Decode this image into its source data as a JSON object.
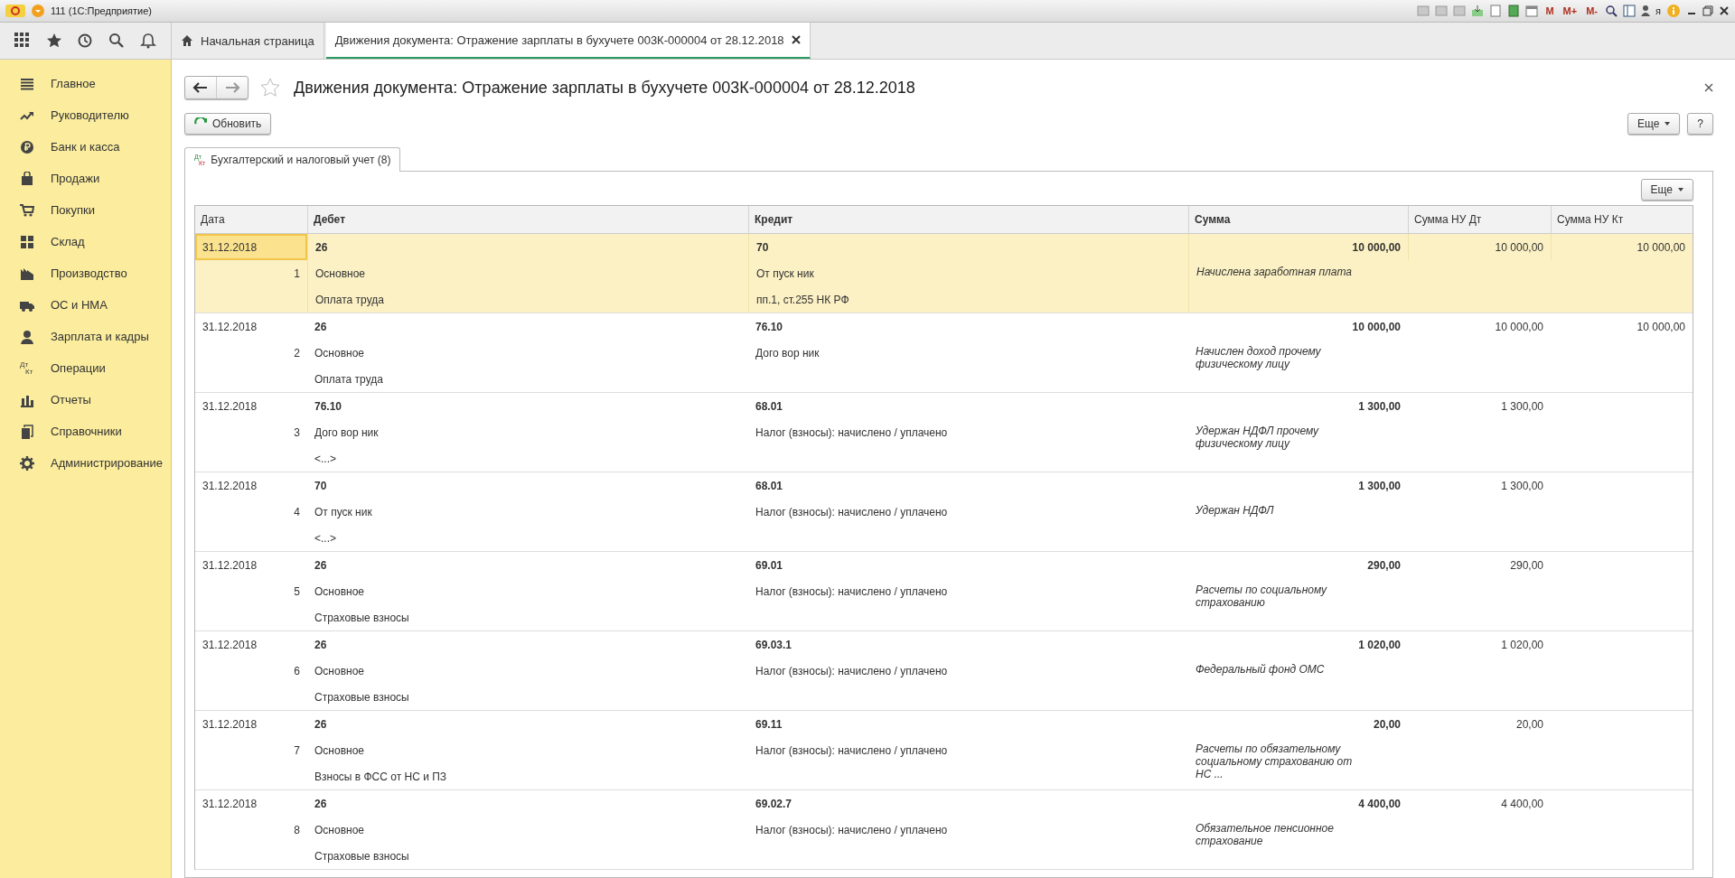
{
  "window": {
    "title": "111 (1С:Предприятие)",
    "memory_buttons": [
      "M",
      "M+",
      "M-"
    ],
    "user": "я"
  },
  "nav_tabs": [
    {
      "label": "Начальная страница",
      "selected": false
    },
    {
      "label": "Движения документа: Отражение зарплаты в бухучете 003К-000004 от 28.12.2018",
      "selected": true
    }
  ],
  "sidebar": {
    "items": [
      {
        "label": "Главное"
      },
      {
        "label": "Руководителю"
      },
      {
        "label": "Банк и касса"
      },
      {
        "label": "Продажи"
      },
      {
        "label": "Покупки"
      },
      {
        "label": "Склад"
      },
      {
        "label": "Производство"
      },
      {
        "label": "ОС и НМА"
      },
      {
        "label": "Зарплата и кадры"
      },
      {
        "label": "Операции",
        "icon_labels": [
          "Дт",
          "Кт"
        ]
      },
      {
        "label": "Отчеты"
      },
      {
        "label": "Справочники"
      },
      {
        "label": "Администрирование"
      }
    ]
  },
  "page": {
    "title": "Движения документа: Отражение зарплаты в бухучете 003К-000004 от 28.12.2018",
    "refresh_button": "Обновить",
    "more_button": "Еще",
    "help_button": "?"
  },
  "section_tabs": [
    {
      "label": "Бухгалтерский и налоговый учет (8)",
      "icon_labels": [
        "Дт",
        "Кт"
      ],
      "selected": true
    }
  ],
  "table": {
    "more_button": "Еще",
    "columns": [
      "Дата",
      "Дебет",
      "Кредит",
      "Сумма",
      "Сумма НУ Дт",
      "Сумма НУ Кт"
    ],
    "rows": [
      {
        "selected": true,
        "date": "31.12.2018",
        "number": "1",
        "debit": [
          "26",
          "Основное",
          "Оплата труда"
        ],
        "credit": [
          "70",
          "От пуск ник",
          "пп.1, ст.255 НК РФ"
        ],
        "amount": "10 000,00",
        "description": "Начислена заработная плата",
        "nu_dt": "10 000,00",
        "nu_kt": "10 000,00"
      },
      {
        "selected": false,
        "date": "31.12.2018",
        "number": "2",
        "debit": [
          "26",
          "Основное",
          "Оплата труда"
        ],
        "credit": [
          "76.10",
          "Дого вор ник"
        ],
        "amount": "10 000,00",
        "description": "Начислен доход прочему физическому лицу",
        "nu_dt": "10 000,00",
        "nu_kt": "10 000,00"
      },
      {
        "selected": false,
        "date": "31.12.2018",
        "number": "3",
        "debit": [
          "76.10",
          "Дого вор ник",
          "<...>"
        ],
        "credit": [
          "68.01",
          "Налог (взносы): начислено / уплачено"
        ],
        "amount": "1 300,00",
        "description": "Удержан НДФЛ прочему физическому лицу",
        "nu_dt": "1 300,00"
      },
      {
        "selected": false,
        "date": "31.12.2018",
        "number": "4",
        "debit": [
          "70",
          "От пуск ник",
          "<...>"
        ],
        "credit": [
          "68.01",
          "Налог (взносы): начислено / уплачено"
        ],
        "amount": "1 300,00",
        "description": "Удержан НДФЛ",
        "nu_dt": "1 300,00"
      },
      {
        "selected": false,
        "date": "31.12.2018",
        "number": "5",
        "debit": [
          "26",
          "Основное",
          "Страховые взносы"
        ],
        "credit": [
          "69.01",
          "Налог (взносы): начислено / уплачено"
        ],
        "amount": "290,00",
        "description": "Расчеты по социальному страхованию",
        "nu_dt": "290,00"
      },
      {
        "selected": false,
        "date": "31.12.2018",
        "number": "6",
        "debit": [
          "26",
          "Основное",
          "Страховые взносы"
        ],
        "credit": [
          "69.03.1",
          "Налог (взносы): начислено / уплачено"
        ],
        "amount": "1 020,00",
        "description": "Федеральный фонд ОМС",
        "nu_dt": "1 020,00"
      },
      {
        "selected": false,
        "date": "31.12.2018",
        "number": "7",
        "debit": [
          "26",
          "Основное",
          "Взносы в ФСС от НС и ПЗ"
        ],
        "credit": [
          "69.11",
          "Налог (взносы): начислено / уплачено"
        ],
        "amount": "20,00",
        "description": "Расчеты по обязательному социальному страхованию от НС ...",
        "nu_dt": "20,00"
      },
      {
        "selected": false,
        "date": "31.12.2018",
        "number": "8",
        "debit": [
          "26",
          "Основное",
          "Страховые взносы"
        ],
        "credit": [
          "69.02.7",
          "Налог (взносы): начислено / уплачено"
        ],
        "amount": "4 400,00",
        "description": "Обязательное пенсионное страхование",
        "nu_dt": "4 400,00"
      }
    ]
  }
}
